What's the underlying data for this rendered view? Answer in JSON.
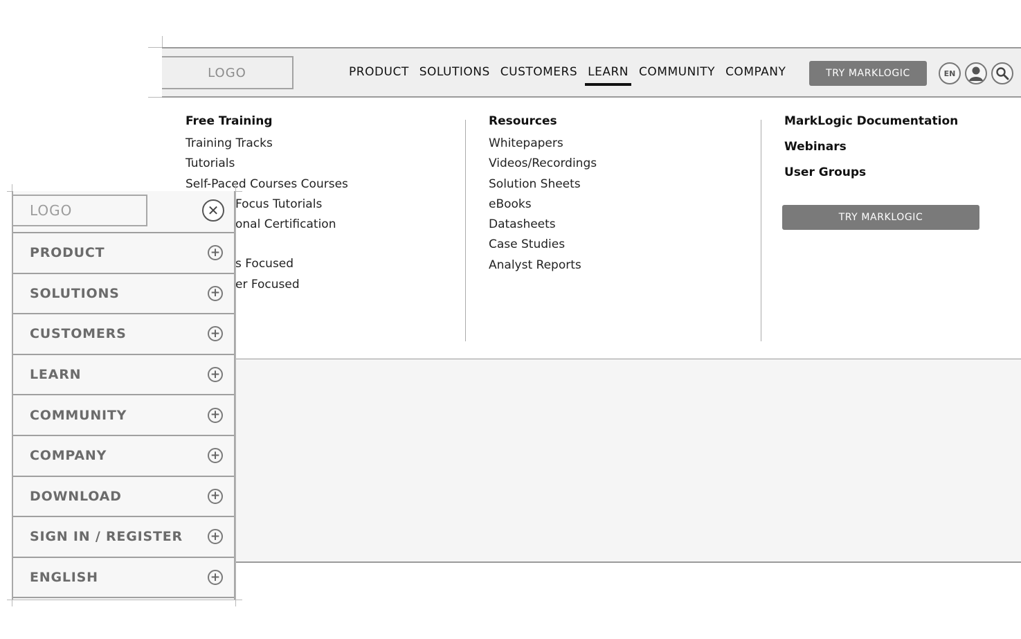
{
  "desktop": {
    "logo": "LOGO",
    "nav": [
      "PRODUCT",
      "SOLUTIONS",
      "CUSTOMERS",
      "LEARN",
      "COMMUNITY",
      "COMPANY"
    ],
    "active_nav": "LEARN",
    "try_button": "TRY MARKLOGIC",
    "lang_icon_label": "EN",
    "icons": [
      "language-icon",
      "user-icon",
      "search-icon"
    ],
    "dropdown": {
      "col1": {
        "heading": "Free Training",
        "links": [
          "Training Tracks",
          "Tutorials",
          "Self-Paced Courses Courses",
          "Focus Tutorials",
          "onal Certification"
        ],
        "links_lower": [
          "s Focused",
          "er Focused"
        ]
      },
      "col2": {
        "heading": "Resources",
        "links": [
          "Whitepapers",
          "Videos/Recordings",
          "Solution Sheets",
          "eBooks",
          "Datasheets",
          "Case Studies",
          "Analyst Reports"
        ]
      },
      "col3": {
        "headings": [
          "MarkLogic Documentation",
          "Webinars",
          "User Groups"
        ],
        "try_button": "TRY MARKLOGIC"
      }
    }
  },
  "mobile": {
    "logo": "LOGO",
    "menu": [
      "PRODUCT",
      "SOLUTIONS",
      "CUSTOMERS",
      "LEARN",
      "COMMUNITY",
      "COMPANY",
      "DOWNLOAD",
      "SIGN IN / REGISTER",
      "ENGLISH"
    ]
  }
}
